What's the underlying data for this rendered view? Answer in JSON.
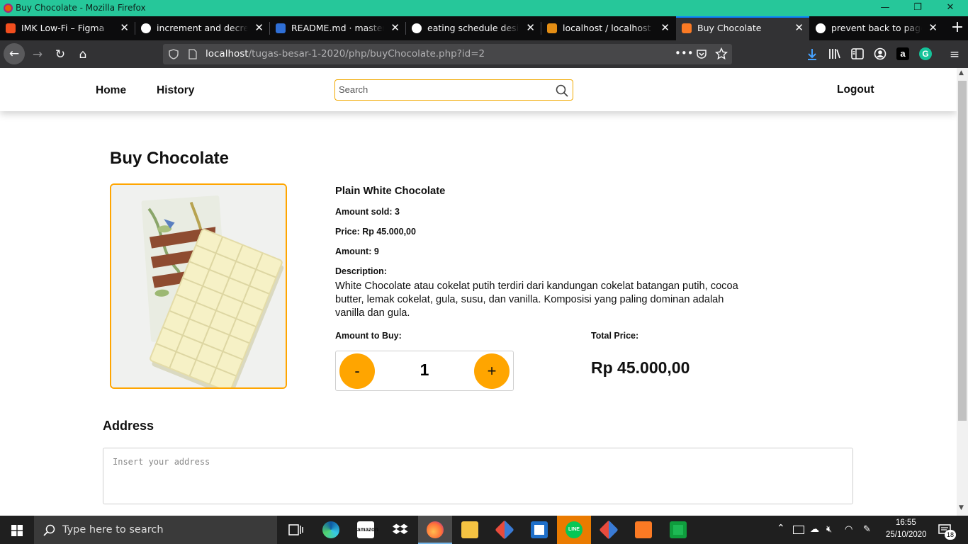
{
  "window": {
    "title": "Buy Chocolate - Mozilla Firefox",
    "minimize": "—",
    "restore": "❐",
    "close": "✕"
  },
  "tabs": [
    {
      "label": "IMK Low-Fi – Figma",
      "icon_color": "#f24e1e"
    },
    {
      "label": "increment and decrement",
      "icon_color": "#ffffff"
    },
    {
      "label": "README.md · master · IF",
      "icon_color": "#2f6fd6"
    },
    {
      "label": "eating schedule design",
      "icon_color": "#ffffff"
    },
    {
      "label": "localhost / localhost / w",
      "icon_color": "#e38d14"
    },
    {
      "label": "Buy Chocolate",
      "icon_color": "#fb7a24"
    },
    {
      "label": "prevent back to page aft",
      "icon_color": "#ffffff"
    }
  ],
  "tab_close": "✕",
  "new_tab": "+",
  "toolbar": {
    "url_host": "localhost",
    "url_path": "/tugas-besar-1-2020/php/buyChocolate.php?id=2",
    "page_actions": "•••",
    "back": "←",
    "forward": "→",
    "reload": "↻",
    "home": "⌂",
    "menu": "≡"
  },
  "nav": {
    "home": "Home",
    "history": "History",
    "logout": "Logout",
    "search_placeholder": "Search"
  },
  "page": {
    "title": "Buy Chocolate"
  },
  "product": {
    "name": "Plain White Chocolate",
    "amount_sold": "Amount sold: 3",
    "price": "Price: Rp 45.000,00",
    "amount": "Amount: 9",
    "description_label": "Description:",
    "description": "White Chocolate atau cokelat putih terdiri dari kandungan cokelat batangan putih, cocoa butter, lemak cokelat, gula, susu, dan vanilla. Komposisi yang paling dominan adalah vanilla dan gula."
  },
  "purchase": {
    "amount_label": "Amount to Buy:",
    "minus": "-",
    "plus": "+",
    "quantity": "1",
    "total_label": "Total Price:",
    "total": "Rp 45.000,00"
  },
  "address": {
    "heading": "Address",
    "placeholder": "Insert your address"
  },
  "taskbar": {
    "search_placeholder": "Type here to search",
    "time": "16:55",
    "date": "25/10/2020",
    "notifications": "18"
  },
  "colors": {
    "accent": "#ffa500",
    "titlebar": "#26c79a",
    "tab_active": "#323234"
  }
}
